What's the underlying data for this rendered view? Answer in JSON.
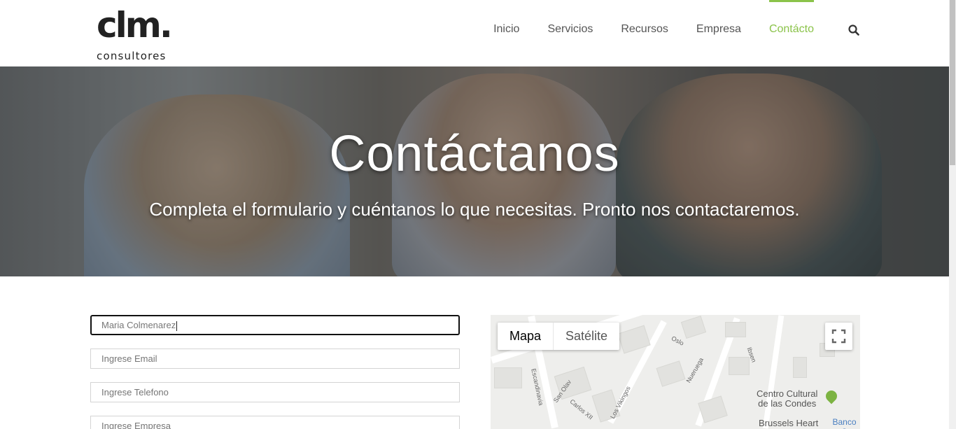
{
  "brand": {
    "mark": "clm.",
    "sub": "consultores"
  },
  "nav": {
    "items": [
      {
        "label": "Inicio",
        "active": false
      },
      {
        "label": "Servicios",
        "active": false
      },
      {
        "label": "Recursos",
        "active": false
      },
      {
        "label": "Empresa",
        "active": false
      },
      {
        "label": "Contácto",
        "active": true
      }
    ],
    "search_icon": "search-icon",
    "accent_color": "#8bc34a"
  },
  "hero": {
    "title": "Contáctanos",
    "subtitle": "Completa el formulario y cuéntanos lo que necesitas. Pronto nos contactaremos."
  },
  "form": {
    "name_value": "Maria Colmenarez",
    "email_placeholder": "Ingrese Email",
    "phone_placeholder": "Ingrese Telefono",
    "company_placeholder": "Ingrese Empresa"
  },
  "map": {
    "type_map": "Mapa",
    "type_satellite": "Satélite",
    "fullscreen_icon": "fullscreen-icon",
    "streets": [
      "Oslo",
      "Ibsen",
      "Escandinavia",
      "Nueruega",
      "San Olav",
      "Carlos XII",
      "Los Vikingos"
    ],
    "poi_1": "Centro Cultural\nde las Condes",
    "poi_2": "Brussels Heart",
    "poi_3": "Banco S"
  }
}
